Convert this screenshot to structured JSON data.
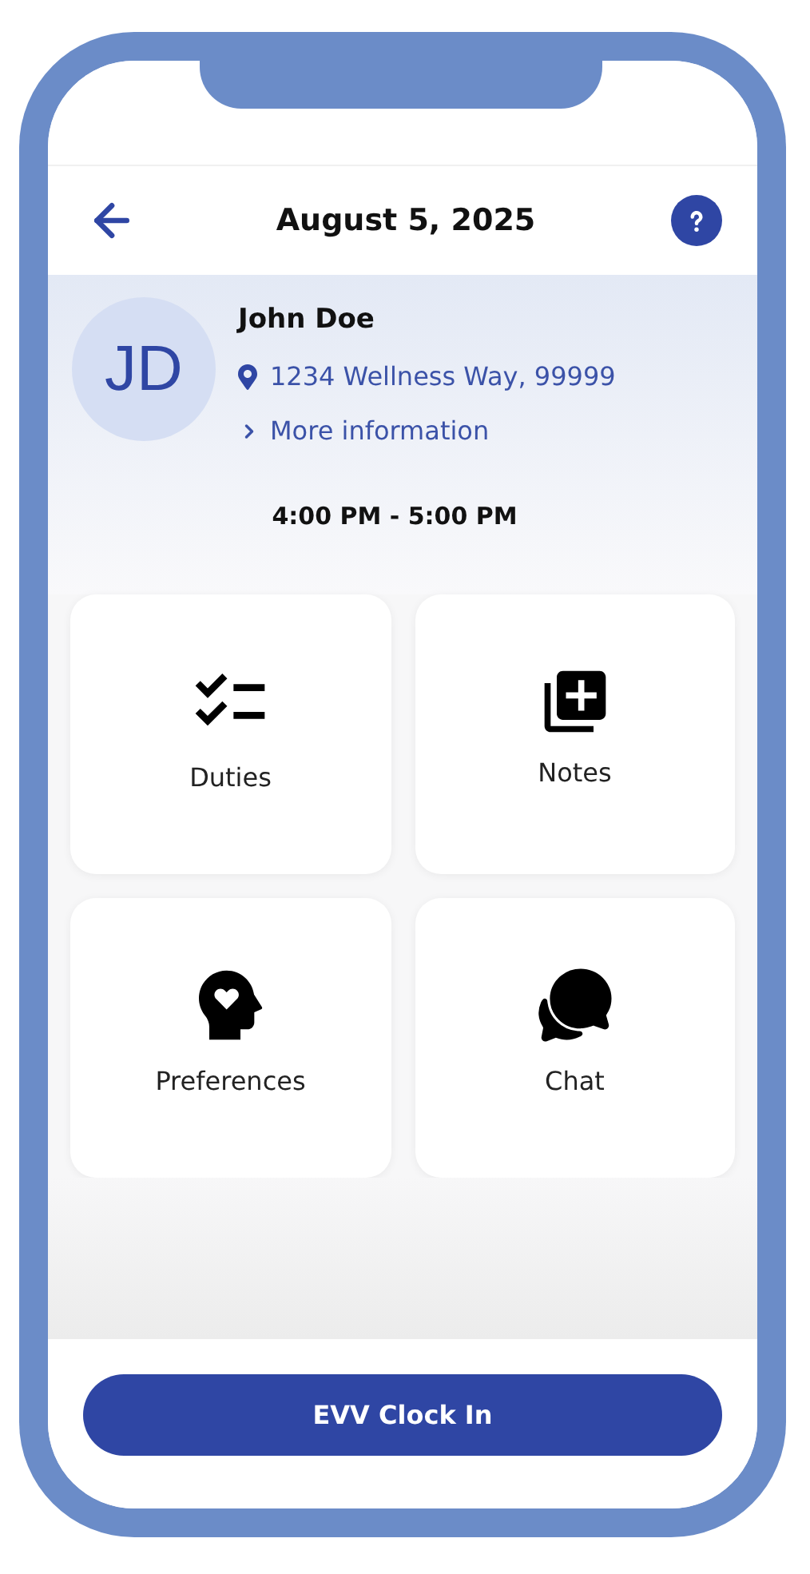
{
  "header": {
    "title": "August 5, 2025"
  },
  "client": {
    "initials": "JD",
    "name": "John Doe",
    "address": "1234 Wellness Way, 99999",
    "more_link": "More information",
    "time": "4:00 PM - 5:00 PM"
  },
  "tiles": [
    {
      "kind": "duties",
      "label": "Duties"
    },
    {
      "kind": "notes",
      "label": "Notes"
    },
    {
      "kind": "preferences",
      "label": "Preferences"
    },
    {
      "kind": "chat",
      "label": "Chat"
    }
  ],
  "primary_button": {
    "label": "EVV Clock In"
  }
}
